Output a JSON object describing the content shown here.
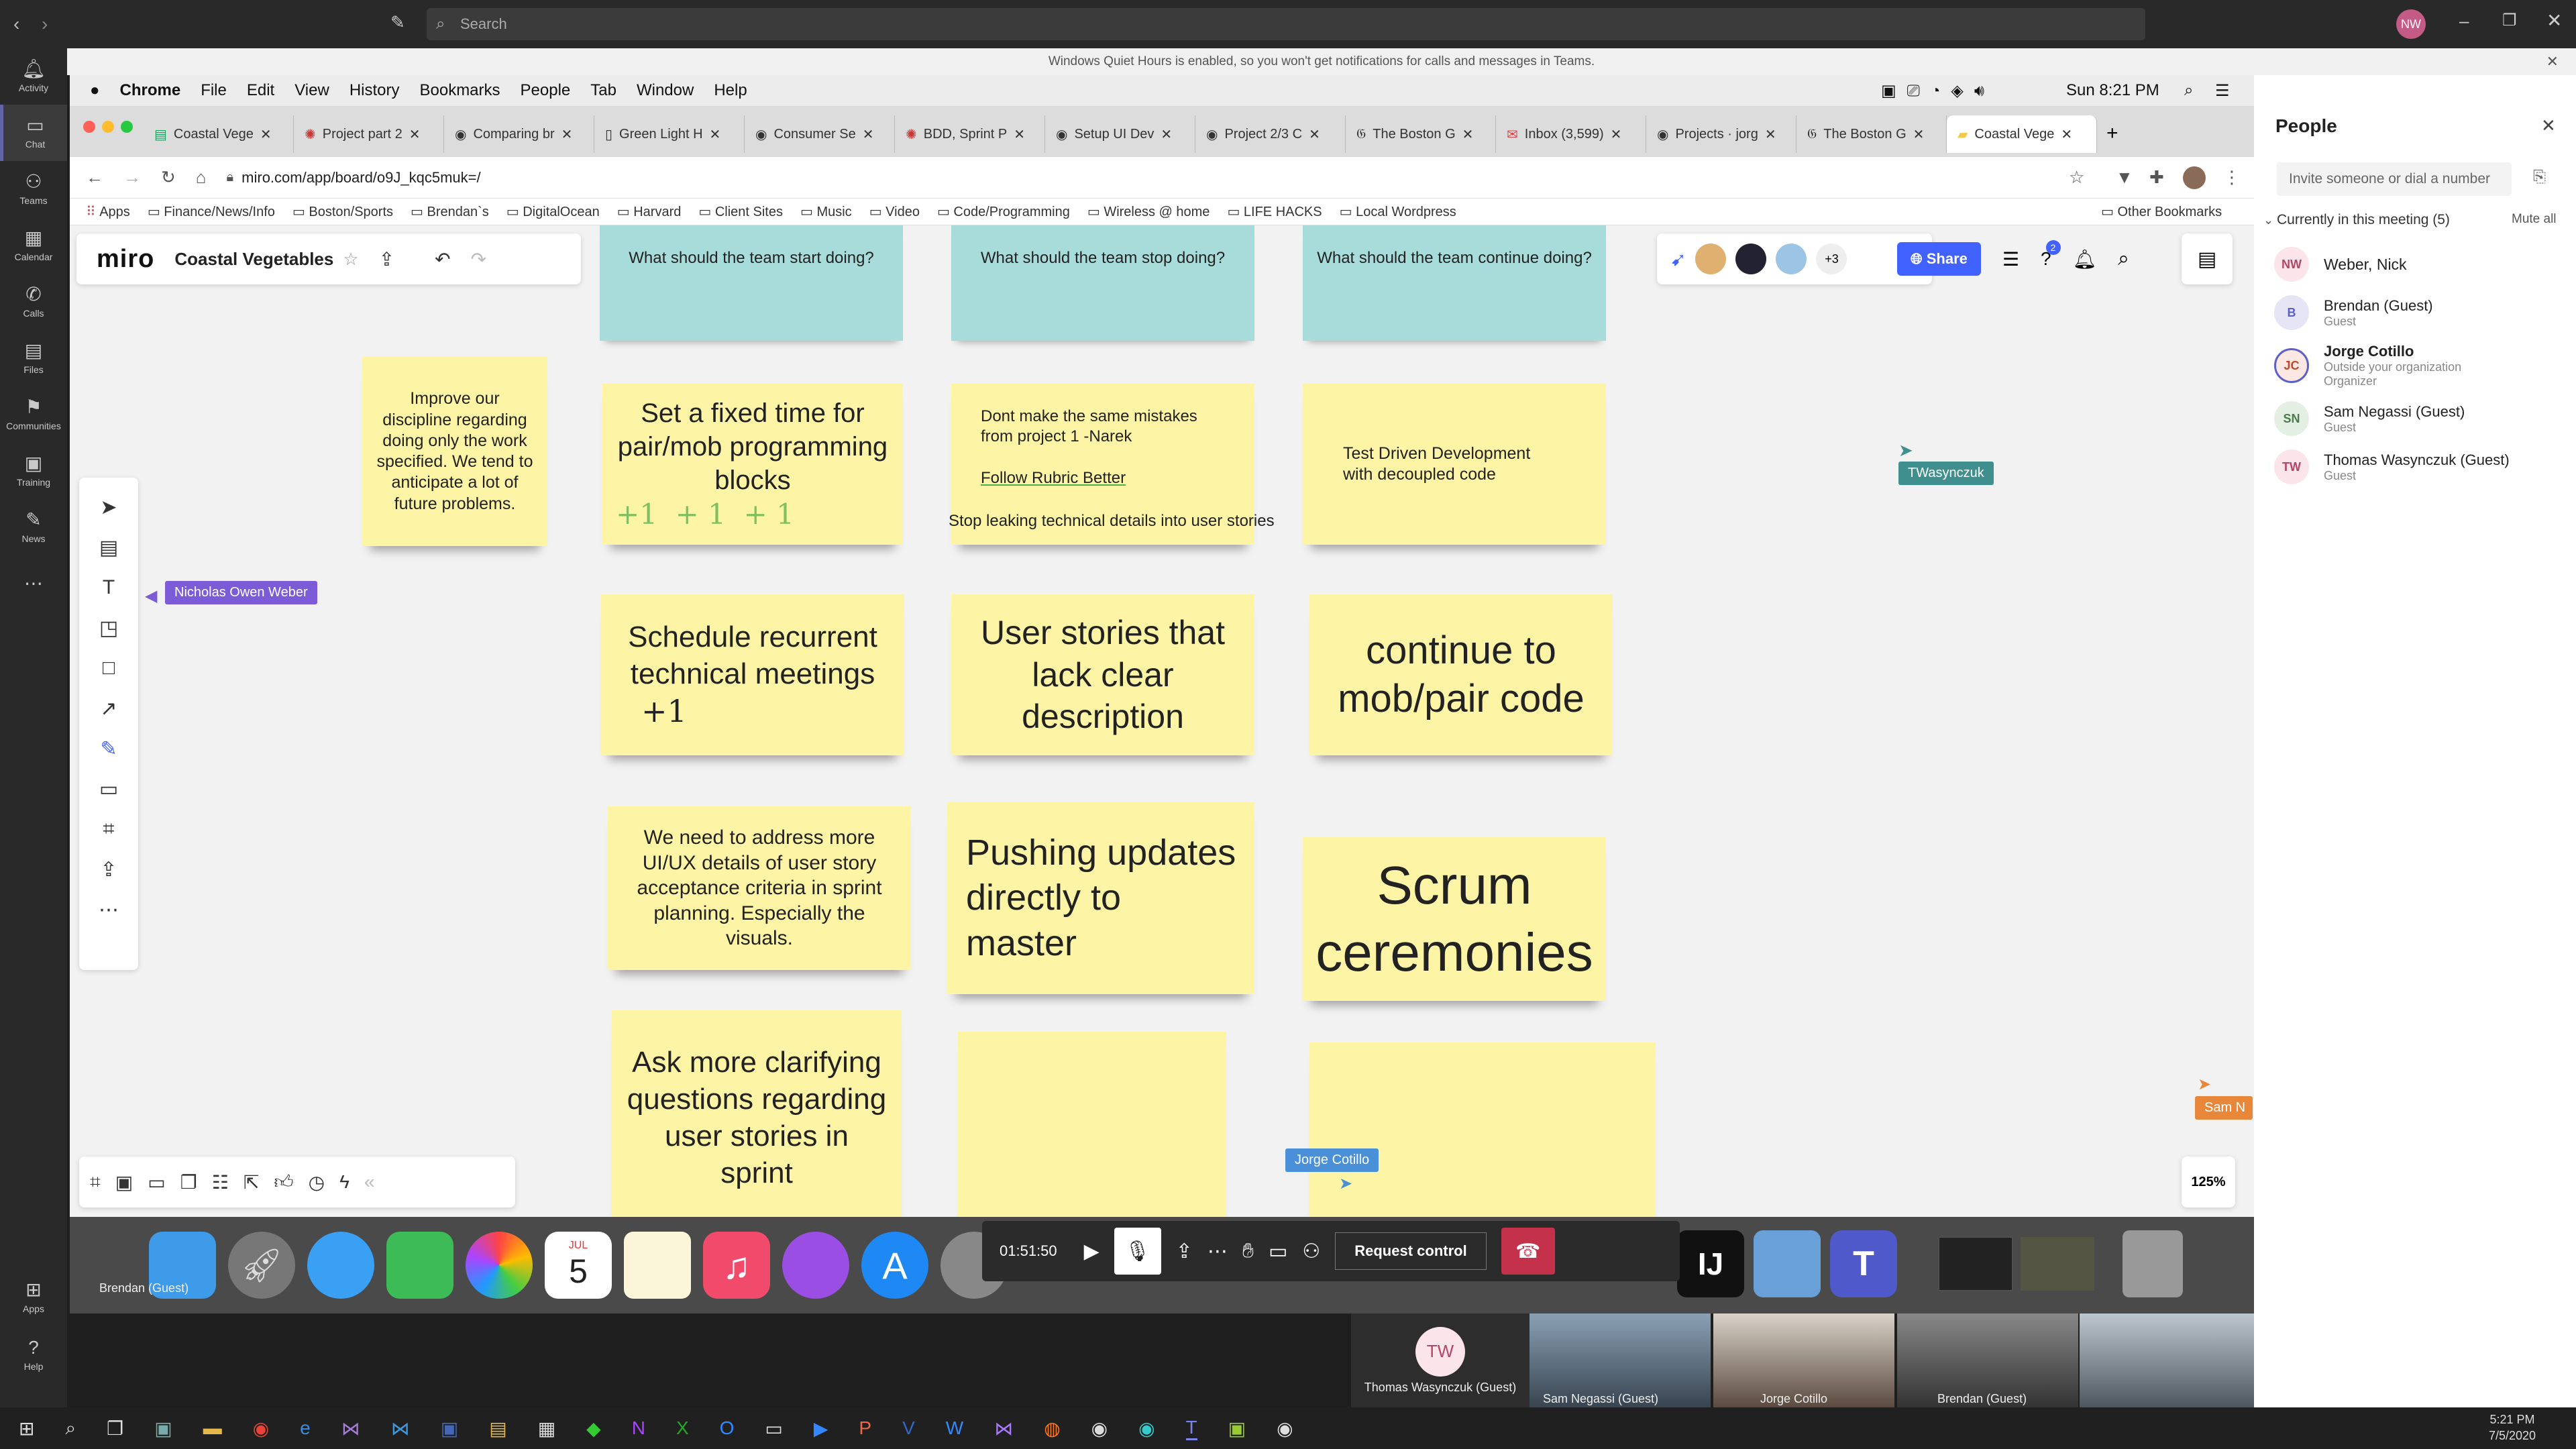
{
  "teams": {
    "search_placeholder": "Search",
    "avatar": "NW",
    "rail": [
      {
        "label": "Activity",
        "icon": "bell-icon"
      },
      {
        "label": "Chat",
        "icon": "chat-icon"
      },
      {
        "label": "Teams",
        "icon": "teams-icon"
      },
      {
        "label": "Calendar",
        "icon": "calendar-icon"
      },
      {
        "label": "Calls",
        "icon": "phone-icon"
      },
      {
        "label": "Files",
        "icon": "file-icon"
      },
      {
        "label": "Communities",
        "icon": "communities-icon"
      },
      {
        "label": "Training",
        "icon": "training-icon"
      },
      {
        "label": "News",
        "icon": "news-icon"
      }
    ],
    "rail_bottom": [
      {
        "label": "Apps"
      },
      {
        "label": "Help"
      }
    ],
    "quiet_hours": "Windows Quiet Hours is enabled, so you won't get notifications for calls and messages in Teams."
  },
  "mac": {
    "menu": [
      "Chrome",
      "File",
      "Edit",
      "View",
      "History",
      "Bookmarks",
      "People",
      "Tab",
      "Window",
      "Help"
    ],
    "clock": "Sun 8:21 PM"
  },
  "chrome": {
    "tabs": [
      "Coastal Vege",
      "Project part 2",
      "Comparing br",
      "Green Light H",
      "Consumer Se",
      "BDD, Sprint P",
      "Setup UI Dev",
      "Project 2/3 C",
      "The Boston G",
      "Inbox (3,599)",
      "Projects · jorg",
      "The Boston G",
      "Coastal Vege"
    ],
    "url": "miro.com/app/board/o9J_kqc5muk=/",
    "bookmarks": [
      "Apps",
      "Finance/News/Info",
      "Boston/Sports",
      "Brendan`s",
      "DigitalOcean",
      "Harvard",
      "Client Sites",
      "Music",
      "Video",
      "Code/Programming",
      "Wireless @ home",
      "LIFE HACKS",
      "Local Wordpress"
    ],
    "other_bookmarks": "Other Bookmarks"
  },
  "miro": {
    "logo": "miro",
    "board_name": "Coastal Vegetables",
    "collab_extra": "+3",
    "share": "Share",
    "zoom": "125%",
    "notif_count": "2",
    "headers": [
      "What should the team start doing?",
      "What should the team stop doing?",
      "What should the team continue doing?"
    ],
    "stickies": {
      "s1": "Improve our discipline regarding doing only the work specified. We tend to anticipate a lot of future problems.",
      "s2": "Set a fixed time for pair/mob programming blocks",
      "s2_votes": "+1  + 1  + 1",
      "s3": "Dont make the same mistakes from project 1 -Narek",
      "s3b": "Follow Rubric Better",
      "s3c": "Stop leaking technical details into user stories",
      "s4": "Test Driven Development with decoupled code",
      "s5": "Schedule recurrent technical meetings",
      "s5_vote": "+1",
      "s6": "User stories that lack clear description",
      "s7": "continue to mob/pair code",
      "s8": "We need to address more UI/UX details of user story acceptance criteria in sprint planning. Especially the visuals.",
      "s9": "Pushing updates directly to master",
      "s10": "Scrum ceremonies",
      "s11": "Ask more clarifying questions regarding user stories in sprint"
    },
    "cursors": {
      "nick": "Nicholas Owen Weber",
      "tw": "TWasynczuk",
      "jorge": "Jorge Cotillo",
      "sam": "Sam N"
    }
  },
  "people": {
    "title": "People",
    "invite_placeholder": "Invite someone or dial a number",
    "section": "Currently in this meeting (5)",
    "mute_all": "Mute all",
    "list": [
      {
        "initials": "NW",
        "name": "Weber, Nick",
        "sub": "",
        "sub2": ""
      },
      {
        "initials": "B",
        "name": "Brendan (Guest)",
        "sub": "Guest",
        "sub2": ""
      },
      {
        "initials": "JC",
        "name": "Jorge Cotillo",
        "sub": "Outside your organization",
        "sub2": "Organizer"
      },
      {
        "initials": "SN",
        "name": "Sam Negassi (Guest)",
        "sub": "Guest",
        "sub2": ""
      },
      {
        "initials": "TW",
        "name": "Thomas Wasynczuk (Guest)",
        "sub": "Guest",
        "sub2": ""
      }
    ]
  },
  "meeting": {
    "timer": "01:51:50",
    "request_control": "Request control",
    "calendar_month": "JUL",
    "calendar_day": "5"
  },
  "video": {
    "left_name": "Brendan (Guest)",
    "tiles": [
      {
        "initials": "TW",
        "name": "Thomas Wasynczuk (Guest)"
      },
      {
        "name": "Sam Negassi (Guest)"
      },
      {
        "name": "Jorge Cotillo"
      },
      {
        "name": "Brendan (Guest)"
      },
      {
        "name": ""
      }
    ]
  },
  "taskbar": {
    "time": "5:21 PM",
    "date": "7/5/2020"
  }
}
